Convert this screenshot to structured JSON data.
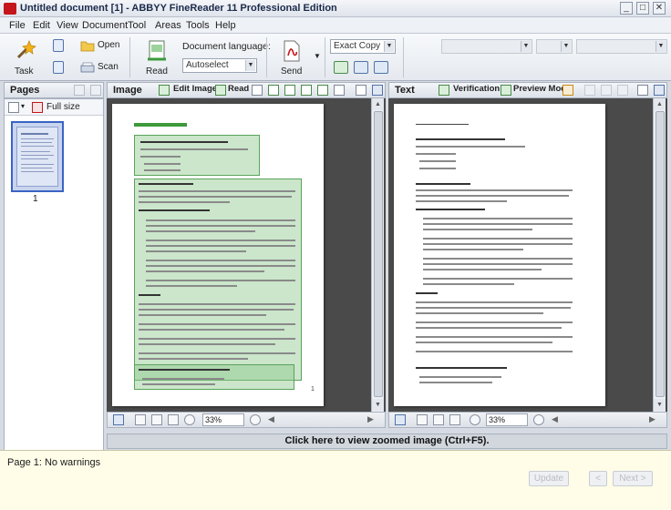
{
  "window": {
    "title": "Untitled document [1] - ABBYY FineReader 11 Professional Edition",
    "min": "_",
    "max": "□",
    "close": "✕"
  },
  "menu": [
    "File",
    "Edit",
    "View",
    "Document",
    "Tool",
    "Areas",
    "Tools",
    "Help"
  ],
  "toolbar": {
    "task_label": "Task",
    "open_label": "Open",
    "scan_label": "Scan",
    "read_label": "Read",
    "lang_caption": "Document language:",
    "lang_value": "Autoselect",
    "send_label": "Send",
    "mode_value": "Exact Copy"
  },
  "pages_pane": {
    "title": "Pages",
    "full_size": "Full size",
    "thumb_number": "1"
  },
  "image_pane": {
    "title": "Image",
    "edit_image": "Edit Image",
    "read": "Read",
    "zoom": "33%"
  },
  "text_pane": {
    "title": "Text",
    "verification": "Verification",
    "preview": "Preview Mode",
    "zoom": "33%"
  },
  "banner": "Click here to view zoomed image (Ctrl+F5).",
  "warnings": {
    "message": "Page 1: No warnings",
    "btn1": "Update",
    "btn2": "<",
    "btn3": "Next >"
  },
  "colors": {
    "accent": "#c4161c",
    "zone_fill": "#8cc88c",
    "zone_border": "#5aa35a",
    "warning_bg": "#fffde8"
  }
}
